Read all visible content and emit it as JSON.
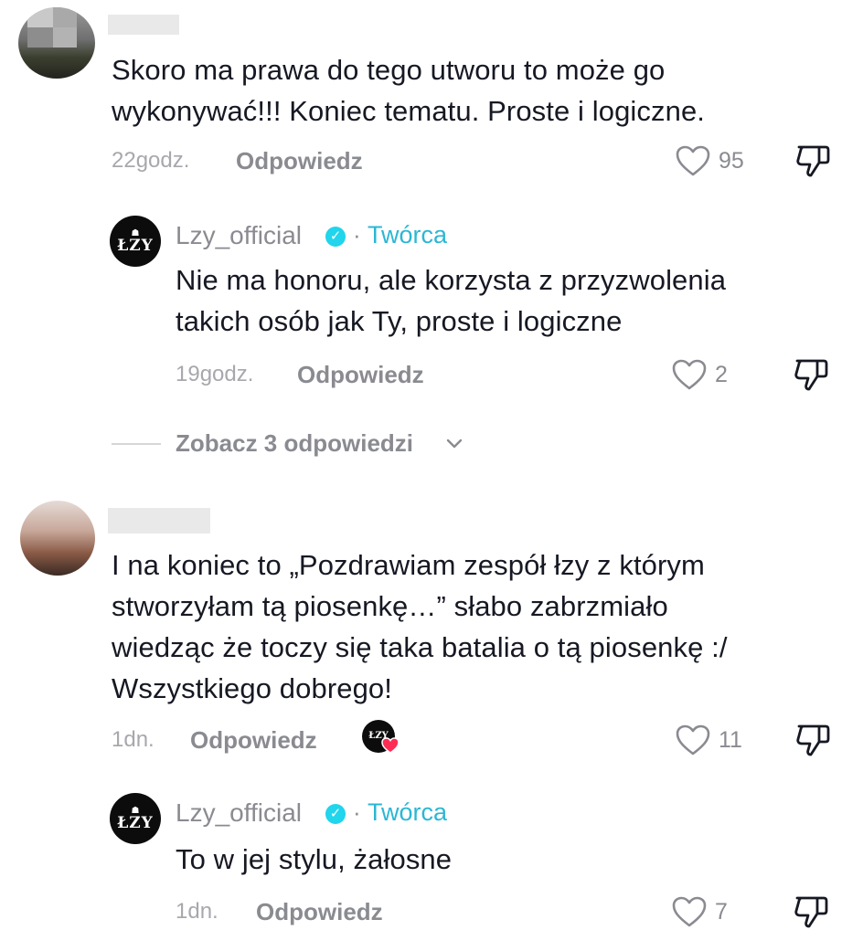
{
  "comments": [
    {
      "text_line1": "Skoro ma prawa do tego utworu to może go",
      "text_line2": "wykonywać!!! Koniec tematu. Proste i logiczne.",
      "time": "22godz.",
      "reply_label": "Odpowiedz",
      "likes": "95",
      "replies": [
        {
          "username": "Lzy_official",
          "separator": "·",
          "badge": "Twórca",
          "text_line1": "Nie ma honoru, ale korzysta z przyzwolenia",
          "text_line2": "takich osób jak Ty, proste i logiczne",
          "time": "19godz.",
          "reply_label": "Odpowiedz",
          "likes": "2"
        }
      ],
      "view_replies": "Zobacz 3 odpowiedzi"
    },
    {
      "text_line1": "I na koniec to „Pozdrawiam zespół łzy z którym",
      "text_line2": "stworzyłam tą piosenkę…” słabo zabrzmiało",
      "text_line3": "wiedząc że toczy się taka batalia o tą piosenkę :/",
      "text_line4": "Wszystkiego dobrego!",
      "time": "1dn.",
      "reply_label": "Odpowiedz",
      "likes": "11",
      "replies": [
        {
          "username": "Lzy_official",
          "separator": "·",
          "badge": "Twórca",
          "text_line1": "To w jej stylu, żałosne",
          "time": "1dn.",
          "reply_label": "Odpowiedz",
          "likes": "7"
        }
      ]
    }
  ],
  "creator_logo": {
    "top": "☗",
    "main": "ŁZY"
  },
  "colors": {
    "creator_label": "#2bb7d3",
    "verified": "#20d5ec",
    "liked_heart": "#fe2c55"
  },
  "icons": [
    "heart-outline-icon",
    "dislike-icon",
    "verified-check-icon",
    "chevron-down-icon",
    "liked-by-creator-icon"
  ]
}
